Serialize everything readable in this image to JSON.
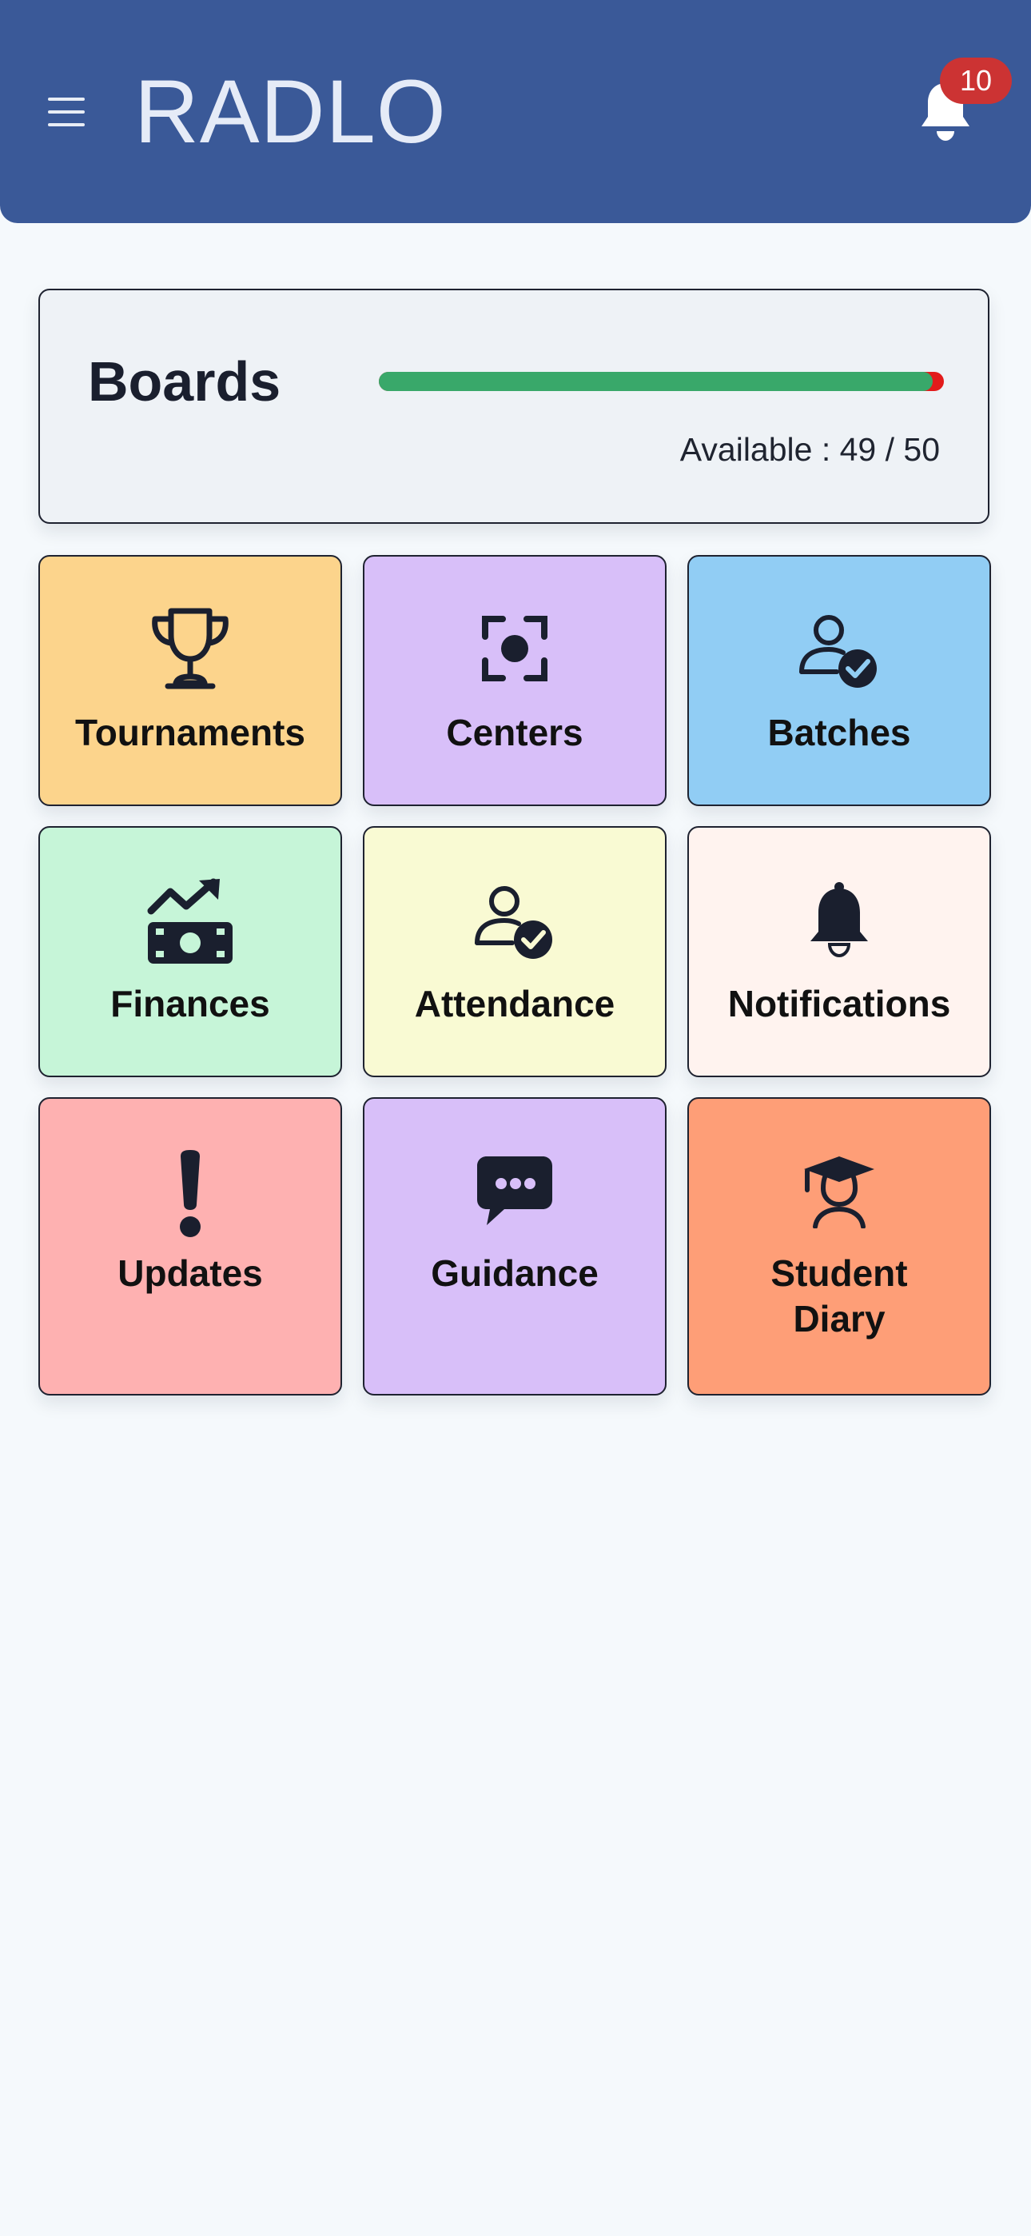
{
  "header": {
    "title": "RADLO",
    "notification_count": "10",
    "menu_icon": "hamburger-menu-icon",
    "bell_icon": "bell-icon",
    "colors": {
      "background": "#3a5998",
      "badge": "#cc3333"
    }
  },
  "boards": {
    "title": "Boards",
    "available_text": "Available : 49 / 50",
    "available": 49,
    "total": 50,
    "colors": {
      "fill": "#39a86a",
      "track": "#e21b1b"
    }
  },
  "tiles": [
    {
      "label": "Tournaments",
      "icon": "trophy-icon",
      "color": "#fcd48c"
    },
    {
      "label": "Centers",
      "icon": "focus-target-icon",
      "color": "#d8bff9"
    },
    {
      "label": "Batches",
      "icon": "user-check-icon",
      "color": "#91cdf4"
    },
    {
      "label": "Finances",
      "icon": "money-trend-icon",
      "color": "#c6f5d8"
    },
    {
      "label": "Attendance",
      "icon": "user-check-icon",
      "color": "#f9fad3"
    },
    {
      "label": "Notifications",
      "icon": "bell-icon",
      "color": "#fff3ef"
    },
    {
      "label": "Updates",
      "icon": "exclamation-icon",
      "color": "#feb1b1"
    },
    {
      "label": "Guidance",
      "icon": "chat-bubble-icon",
      "color": "#d8bff9"
    },
    {
      "label": "Student\nDiary",
      "icon": "student-icon",
      "color": "#fe9e77"
    }
  ]
}
